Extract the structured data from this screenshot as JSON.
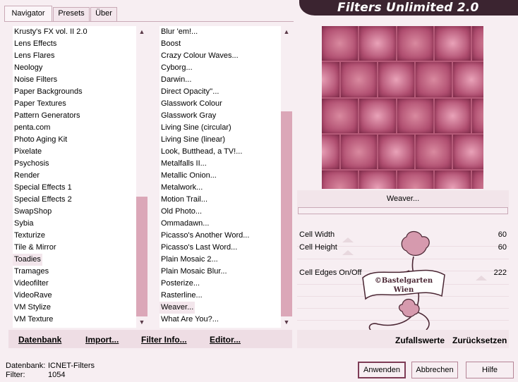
{
  "app": {
    "title": "Filters Unlimited 2.0"
  },
  "tabs": [
    {
      "label": "Navigator"
    },
    {
      "label": "Presets"
    },
    {
      "label": "Über"
    }
  ],
  "categories": [
    "Krusty's FX vol. II 2.0",
    "Lens Effects",
    "Lens Flares",
    "Neology",
    "Noise Filters",
    "Paper Backgrounds",
    "Paper Textures",
    "Pattern Generators",
    "penta.com",
    "Photo Aging Kit",
    "Pixelate",
    "Psychosis",
    "Render",
    "Special Effects 1",
    "Special Effects 2",
    "SwapShop",
    "Sybia",
    "Texturize",
    "Tile & Mirror",
    "Toadies",
    "Tramages",
    "Videofilter",
    "VideoRave",
    "VM Stylize",
    "VM Texture"
  ],
  "filters": [
    "Blur 'em!...",
    "Boost",
    "Crazy Colour Waves...",
    "Cyborg...",
    "Darwin...",
    "Direct Opacity''...",
    "Glasswork Colour",
    "Glasswork Gray",
    "Living Sine (circular)",
    "Living Sine (linear)",
    "Look, Butthead, a TV!...",
    "Metalfalls II...",
    "Metallic Onion...",
    "Metalwork...",
    "Motion Trail...",
    "Old Photo...",
    "Ommadawn...",
    "Picasso's Another Word...",
    "Picasso's Last Word...",
    "Plain Mosaic 2...",
    "Plain Mosaic Blur...",
    "Posterize...",
    "Rasterline...",
    "Weaver...",
    "What Are You?..."
  ],
  "selected": {
    "category": "Toadies",
    "filter": "Weaver..."
  },
  "toolbar": {
    "datenbank": "Datenbank",
    "import": "Import...",
    "filter_info": "Filter Info...",
    "editor": "Editor..."
  },
  "preview": {
    "filter_name": "Weaver..."
  },
  "params": [
    {
      "label": "Cell Width",
      "value": "60",
      "level": 0.24
    },
    {
      "label": "Cell Height",
      "value": "60",
      "level": 0.24
    },
    {
      "label": "Cell Edges On/Off",
      "value": "222",
      "level": 0.87
    }
  ],
  "right_actions": {
    "random": "Zufallswerte",
    "reset": "Zurücksetzen"
  },
  "status": {
    "db_label": "Datenbank:",
    "db_value": "ICNET-Filters",
    "filter_label": "Filter:",
    "filter_value": "1054"
  },
  "buttons": {
    "apply": "Anwenden",
    "cancel": "Abbrechen",
    "help": "Hilfe"
  },
  "watermark": {
    "line1": "©Bastelgarten",
    "line2": "Wien"
  },
  "colors": {
    "accent": "#7e3c56",
    "thumb": "#dba7b8",
    "banner": "#3b2430",
    "preview": "#b55a78"
  }
}
